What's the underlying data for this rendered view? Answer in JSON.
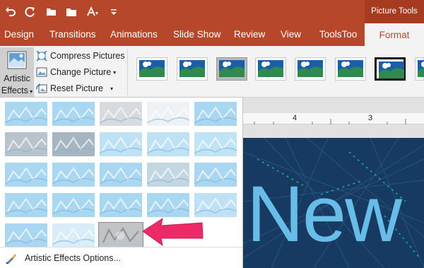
{
  "quick_access": {
    "icons": [
      "undo-icon",
      "redo-icon",
      "open-icon",
      "folder-icon",
      "font-size-icon",
      "customize-icon"
    ]
  },
  "context_label": "Picture Tools",
  "tabs": [
    {
      "label": "Design"
    },
    {
      "label": "Transitions"
    },
    {
      "label": "Animations"
    },
    {
      "label": "Slide Show"
    },
    {
      "label": "Review"
    },
    {
      "label": "View"
    },
    {
      "label": "ToolsToo"
    },
    {
      "label": "Format"
    }
  ],
  "ribbon": {
    "artistic_effects": {
      "line1": "Artistic",
      "line2": "Effects"
    },
    "commands": [
      {
        "label": "Compress Pictures"
      },
      {
        "label": "Change Picture"
      },
      {
        "label": "Reset Picture"
      }
    ]
  },
  "ruler": {
    "marks": [
      "4",
      "3"
    ]
  },
  "slide": {
    "text": "New"
  },
  "effects_menu": {
    "rows": 5,
    "columns": 5,
    "selected": "row 5, column 3",
    "options_label": "Artistic Effects Options..."
  },
  "colors": {
    "titlebar": "#b7472a",
    "ribbon": "#f3f3f3",
    "slide_bg": "#163a62",
    "slide_text": "#67bce8",
    "arrow": "#ec2a67"
  }
}
